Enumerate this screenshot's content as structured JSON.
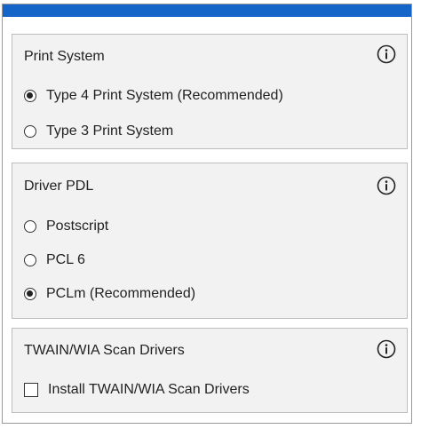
{
  "colors": {
    "title_bar": "#1565c8",
    "panel_bg": "#f2f2f2",
    "panel_border": "#bdbdbd"
  },
  "print_system": {
    "title": "Print System",
    "info_icon": "info-icon",
    "options": [
      {
        "label": "Type 4 Print System (Recommended)",
        "selected": true
      },
      {
        "label": "Type 3 Print System",
        "selected": false
      }
    ]
  },
  "driver_pdl": {
    "title": "Driver PDL",
    "info_icon": "info-icon",
    "options": [
      {
        "label": "Postscript",
        "selected": false
      },
      {
        "label": "PCL 6",
        "selected": false
      },
      {
        "label": "PCLm (Recommended)",
        "selected": true
      }
    ]
  },
  "twain": {
    "title": "TWAIN/WIA Scan Drivers",
    "info_icon": "info-icon",
    "checkbox": {
      "label": "Install TWAIN/WIA Scan Drivers",
      "checked": false
    }
  }
}
